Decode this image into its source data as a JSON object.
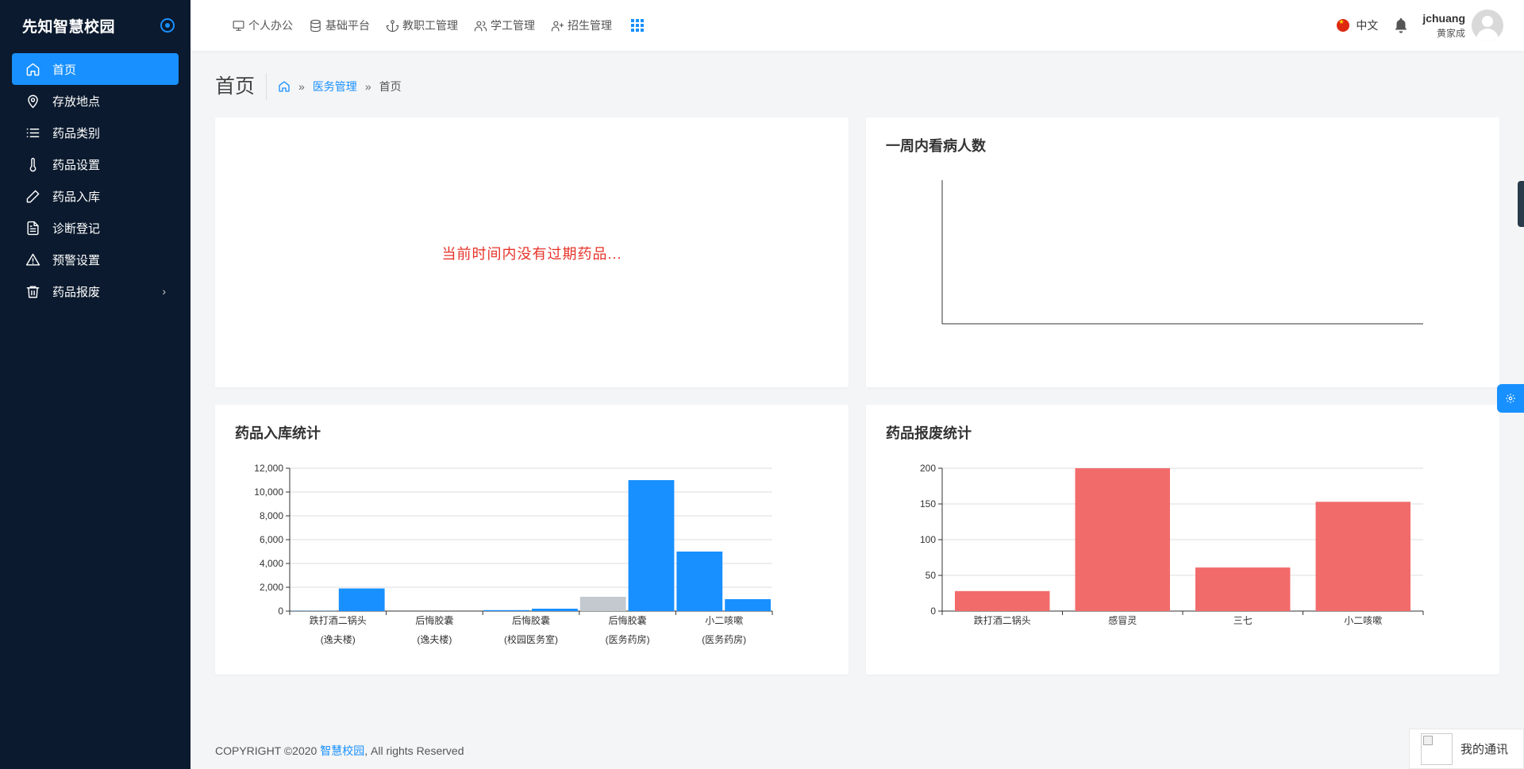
{
  "app": {
    "title": "先知智慧校园"
  },
  "sidebar": {
    "items": [
      {
        "label": "首页",
        "icon": "home-icon",
        "active": true
      },
      {
        "label": "存放地点",
        "icon": "map-pin-icon"
      },
      {
        "label": "药品类别",
        "icon": "list-icon"
      },
      {
        "label": "药品设置",
        "icon": "thermometer-icon"
      },
      {
        "label": "药品入库",
        "icon": "pencil-icon"
      },
      {
        "label": "诊断登记",
        "icon": "document-icon"
      },
      {
        "label": "预警设置",
        "icon": "warning-icon"
      },
      {
        "label": "药品报废",
        "icon": "trash-icon",
        "has_submenu": true
      }
    ]
  },
  "header": {
    "nav": [
      {
        "label": "个人办公",
        "icon": "monitor-icon"
      },
      {
        "label": "基础平台",
        "icon": "database-icon"
      },
      {
        "label": "教职工管理",
        "icon": "anchor-icon"
      },
      {
        "label": "学工管理",
        "icon": "users-icon"
      },
      {
        "label": "招生管理",
        "icon": "user-plus-icon"
      }
    ],
    "language": "中文",
    "user": {
      "name": "jchuang",
      "display_name": "黄家成"
    }
  },
  "breadcrumb": {
    "title": "首页",
    "module": "医务管理",
    "current": "首页"
  },
  "cards": {
    "expired": {
      "title": "",
      "empty_message": "当前时间内没有过期药品..."
    },
    "patients": {
      "title": "一周内看病人数"
    },
    "stock_in": {
      "title": "药品入库统计"
    },
    "scrap": {
      "title": "药品报废统计"
    }
  },
  "chart_data": [
    {
      "type": "line",
      "title": "一周内看病人数",
      "x": [],
      "series": []
    },
    {
      "type": "bar",
      "title": "药品入库统计",
      "categories": [
        {
          "line1": "跌打酒二锅头",
          "line2": "(逸夫楼)"
        },
        {
          "line1": "后悔胶囊",
          "line2": "(逸夫楼)"
        },
        {
          "line1": "后悔胶囊",
          "line2": "(校园医务室)"
        },
        {
          "line1": "后悔胶囊",
          "line2": "(医务药房)"
        },
        {
          "line1": "小二咳嗽",
          "line2": "(医务药房)"
        }
      ],
      "bars": [
        {
          "value": 20,
          "color": "#1890ff"
        },
        {
          "value": 1900,
          "color": "#1890ff"
        },
        {
          "value": 0,
          "color": "#1890ff"
        },
        {
          "value": 0,
          "color": "#1890ff"
        },
        {
          "value": 80,
          "color": "#1890ff"
        },
        {
          "value": 200,
          "color": "#1890ff"
        },
        {
          "value": 1200,
          "color": "#c4c9cf"
        },
        {
          "value": 11000,
          "color": "#1890ff"
        },
        {
          "value": 5000,
          "color": "#1890ff"
        },
        {
          "value": 1000,
          "color": "#1890ff"
        }
      ],
      "yticks": [
        "0",
        "2,000",
        "4,000",
        "6,000",
        "8,000",
        "10,000",
        "12,000"
      ],
      "ylim": [
        0,
        12000
      ],
      "grid": true
    },
    {
      "type": "bar",
      "title": "药品报废统计",
      "categories": [
        "跌打酒二锅头",
        "感冒灵",
        "三七",
        "小二咳嗽"
      ],
      "values": [
        28,
        200,
        61,
        153
      ],
      "color": "#f26b6b",
      "yticks": [
        "0",
        "50",
        "100",
        "150",
        "200"
      ],
      "ylim": [
        0,
        200
      ],
      "grid": true
    }
  ],
  "footer": {
    "prefix": "COPYRIGHT ©2020 ",
    "link": "智慧校园",
    "suffix": ", All rights Reserved"
  },
  "im": {
    "label": "我的通讯"
  },
  "colors": {
    "sidebar_bg": "#0b1a2e",
    "accent": "#1890ff",
    "bar_blue": "#1890ff",
    "bar_red": "#f26b6b",
    "alert": "#e6332a"
  }
}
